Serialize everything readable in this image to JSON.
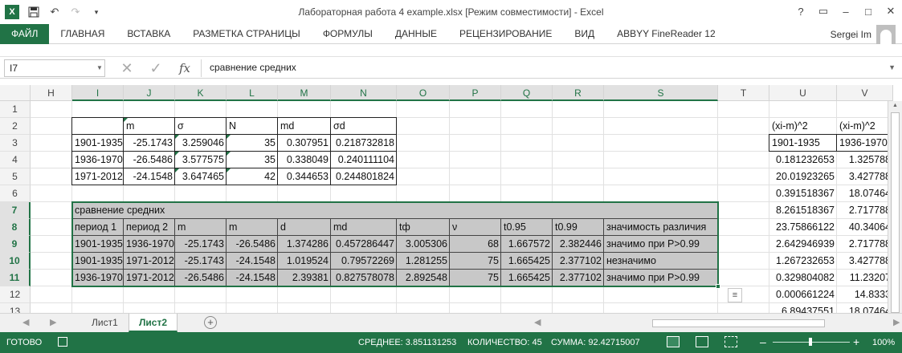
{
  "window": {
    "title": "Лабораторная работа 4 example.xlsx  [Режим совместимости] - Excel",
    "help": "?"
  },
  "ribbon": {
    "file_tab": "ФАЙЛ",
    "tabs": [
      "ГЛАВНАЯ",
      "ВСТАВКА",
      "РАЗМЕТКА СТРАНИЦЫ",
      "ФОРМУЛЫ",
      "ДАННЫЕ",
      "РЕЦЕНЗИРОВАНИЕ",
      "ВИД",
      "ABBYY FineReader 12"
    ],
    "user": "Sergei Im"
  },
  "formula_bar": {
    "name_box": "I7",
    "fx": "fx",
    "formula": "сравнение средних"
  },
  "columns": [
    "H",
    "I",
    "J",
    "K",
    "L",
    "M",
    "N",
    "O",
    "P",
    "Q",
    "R",
    "S",
    "T",
    "U",
    "V"
  ],
  "rows": [
    "1",
    "2",
    "3",
    "4",
    "5",
    "6",
    "7",
    "8",
    "9",
    "10",
    "11",
    "12",
    "13"
  ],
  "table1": {
    "headers": [
      "m",
      "σ",
      "N",
      "md",
      "σd"
    ],
    "rows": [
      [
        "1901-1935",
        "-25.1743",
        "3.259046",
        "35",
        "0.307951",
        "0.218732818"
      ],
      [
        "1936-1970",
        "-26.5486",
        "3.577575",
        "35",
        "0.338049",
        "0.240111104"
      ],
      [
        "1971-2012",
        "-24.1548",
        "3.647465",
        "42",
        "0.344653",
        "0.244801824"
      ]
    ]
  },
  "table2": {
    "title": "сравнение средних",
    "headers": [
      "период 1",
      "период 2",
      "m",
      "m",
      "d",
      "md",
      "tф",
      "ν",
      "t0.95",
      "t0.99",
      "значимость различия"
    ],
    "rows": [
      [
        "1901-1935",
        "1936-1970",
        "-25.1743",
        "-26.5486",
        "1.374286",
        "0.457286447",
        "3.005306",
        "68",
        "1.667572",
        "2.382446",
        "значимо при P>0.99"
      ],
      [
        "1901-1935",
        "1971-2012",
        "-25.1743",
        "-24.1548",
        "1.019524",
        "0.79572269",
        "1.281255",
        "75",
        "1.665425",
        "2.377102",
        "незначимо"
      ],
      [
        "1936-1970",
        "1971-2012",
        "-26.5486",
        "-24.1548",
        "2.39381",
        "0.827578078",
        "2.892548",
        "75",
        "1.665425",
        "2.377102",
        "значимо при P>0.99"
      ]
    ]
  },
  "side": {
    "u_header": "(xi-m)^2",
    "v_header": "(xi-m)^2",
    "u3": "1901-1935",
    "v3": "1936-1970",
    "u_vals": [
      "0.181232653",
      "20.01923265",
      "0.391518367",
      "8.261518367",
      "23.75866122",
      "2.642946939",
      "1.267232653",
      "0.329804082",
      "0.000661224",
      "6.89437551"
    ],
    "v_vals": [
      "1.325788",
      "3.427788",
      "18.07464",
      "2.717788",
      "40.34064",
      "2.717788",
      "3.427788",
      "11.23207",
      "14.8333",
      "18.07464"
    ]
  },
  "sheets": [
    "Лист1",
    "Лист2"
  ],
  "status": {
    "ready": "ГОТОВО",
    "average": "СРЕДНЕЕ: 3.851131253",
    "count": "КОЛИЧЕСТВО: 45",
    "sum": "СУММА: 92.42715007",
    "zoom": "100%"
  },
  "colors": {
    "accent": "#217346",
    "selection_fill": "#c8c8c8"
  }
}
